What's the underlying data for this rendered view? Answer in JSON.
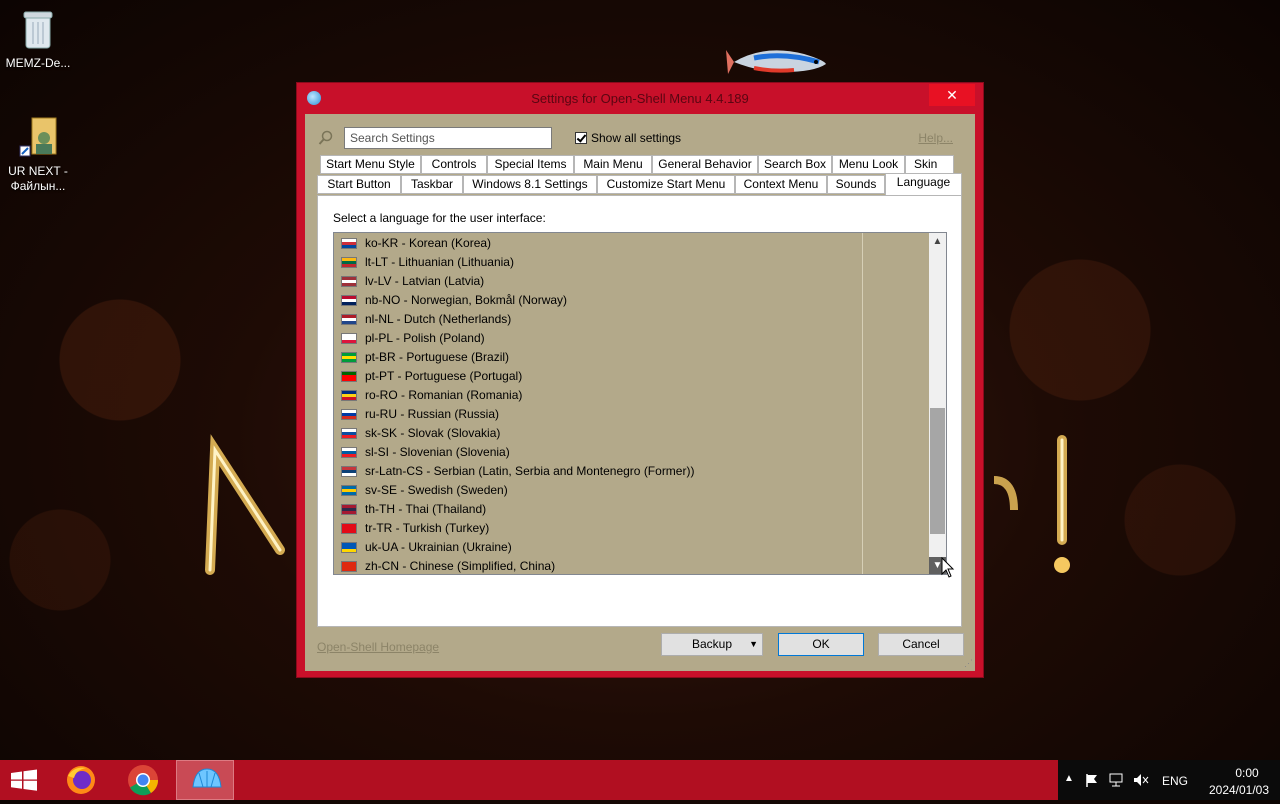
{
  "desktop": {
    "icons": [
      {
        "label": "MEMZ-De..."
      },
      {
        "label_line1": "UR NEXT -",
        "label_line2": "Файлын..."
      }
    ]
  },
  "window": {
    "title": "Settings for Open-Shell Menu 4.4.189",
    "close_glyph": "✕",
    "search_placeholder": "Search Settings",
    "show_all_label": "Show all settings",
    "help_label": "Help...",
    "tabs_row1": [
      "Start Menu Style",
      "Controls",
      "Special Items",
      "Main Menu",
      "General Behavior",
      "Search Box",
      "Menu Look",
      "Skin"
    ],
    "tabs_row2": [
      "Start Button",
      "Taskbar",
      "Windows 8.1 Settings",
      "Customize Start Menu",
      "Context Menu",
      "Sounds",
      "Language"
    ],
    "active_tab": "Language",
    "panel_label": "Select a language for the user interface:",
    "languages": [
      {
        "text": "ko-KR - Korean (Korea)",
        "colors": [
          "#ffffff",
          "#cd2e3a",
          "#0047a0"
        ]
      },
      {
        "text": "lt-LT - Lithuanian (Lithuania)",
        "colors": [
          "#fdb913",
          "#006a44",
          "#c1272d"
        ]
      },
      {
        "text": "lv-LV - Latvian (Latvia)",
        "colors": [
          "#9e3039",
          "#ffffff",
          "#9e3039"
        ]
      },
      {
        "text": "nb-NO - Norwegian, Bokmål (Norway)",
        "colors": [
          "#ba0c2f",
          "#ffffff",
          "#00205b"
        ]
      },
      {
        "text": "nl-NL - Dutch (Netherlands)",
        "colors": [
          "#ae1c28",
          "#ffffff",
          "#21468b"
        ]
      },
      {
        "text": "pl-PL - Polish (Poland)",
        "colors": [
          "#ffffff",
          "#ffffff",
          "#dc143c"
        ]
      },
      {
        "text": "pt-BR - Portuguese (Brazil)",
        "colors": [
          "#009c3b",
          "#ffdf00",
          "#009c3b"
        ]
      },
      {
        "text": "pt-PT - Portuguese (Portugal)",
        "colors": [
          "#006600",
          "#ff0000",
          "#ff0000"
        ]
      },
      {
        "text": "ro-RO - Romanian (Romania)",
        "colors": [
          "#002b7f",
          "#fcd116",
          "#ce1126"
        ]
      },
      {
        "text": "ru-RU - Russian (Russia)",
        "colors": [
          "#ffffff",
          "#0039a6",
          "#d52b1e"
        ]
      },
      {
        "text": "sk-SK - Slovak (Slovakia)",
        "colors": [
          "#ffffff",
          "#0b4ea2",
          "#ee1c25"
        ]
      },
      {
        "text": "sl-SI - Slovenian (Slovenia)",
        "colors": [
          "#ffffff",
          "#005da4",
          "#ed1c24"
        ]
      },
      {
        "text": "sr-Latn-CS - Serbian (Latin, Serbia and Montenegro (Former))",
        "colors": [
          "#c6363c",
          "#0c4076",
          "#ffffff"
        ]
      },
      {
        "text": "sv-SE - Swedish (Sweden)",
        "colors": [
          "#006aa7",
          "#fecc00",
          "#006aa7"
        ]
      },
      {
        "text": "th-TH - Thai (Thailand)",
        "colors": [
          "#a51931",
          "#2d2a4a",
          "#a51931"
        ]
      },
      {
        "text": "tr-TR - Turkish (Turkey)",
        "colors": [
          "#e30a17",
          "#e30a17",
          "#e30a17"
        ]
      },
      {
        "text": "uk-UA - Ukrainian (Ukraine)",
        "colors": [
          "#0057b7",
          "#0057b7",
          "#ffd700"
        ]
      },
      {
        "text": "zh-CN - Chinese (Simplified, China)",
        "colors": [
          "#de2910",
          "#de2910",
          "#de2910"
        ]
      }
    ],
    "homepage_link": "Open-Shell Homepage",
    "backup_label": "Backup",
    "ok_label": "OK",
    "cancel_label": "Cancel"
  },
  "taskbar": {
    "apps": [
      "start-icon",
      "firefox-icon",
      "chrome-icon",
      "open-shell-icon"
    ],
    "lang": "ENG",
    "time": "0:00",
    "date": "2024/01/03"
  },
  "colors": {
    "window_frame": "#c8102a",
    "client_bg": "#b3a98a",
    "taskbar": "#b10f21",
    "close_btn": "#e81123"
  }
}
